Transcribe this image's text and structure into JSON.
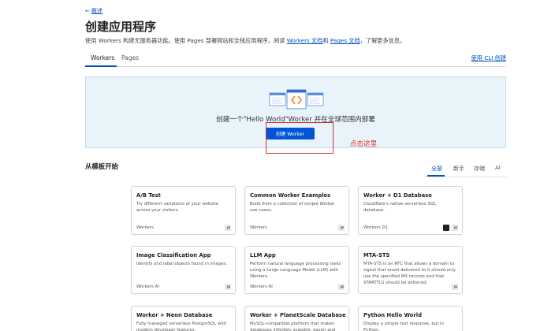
{
  "header": {
    "back_label": "概述",
    "title": "创建应用程序",
    "desc_prefix": "使用 Workers 构建无服务器功能。使用 Pages 部署网站和全栈应用程序。阅读 ",
    "workers_docs_link": "Workers 文档",
    "desc_and": "和 ",
    "pages_docs_link": "Pages 文档",
    "desc_suffix": "，了解更多信息。"
  },
  "tabs": [
    {
      "label": "Workers",
      "active": true
    },
    {
      "label": "Pages",
      "active": false
    }
  ],
  "cli_link": "使用 CLI 创建",
  "hero": {
    "text": "创建一个\"Hello World\"Worker 并在全球范围内部署",
    "button": "创建 Worker",
    "annotation": "点击这里"
  },
  "templates": {
    "title": "从模板开始",
    "filters": [
      {
        "label": "全部",
        "active": true
      },
      {
        "label": "新手",
        "active": false
      },
      {
        "label": "存储",
        "active": false
      },
      {
        "label": "AI",
        "active": false
      }
    ],
    "cards": [
      {
        "title": "A/B Test",
        "desc": "Try different variations of your website across your visitors.",
        "tags": "Workers",
        "badges": [
          "js"
        ]
      },
      {
        "title": "Common Worker Examples",
        "desc": "Build from a collection of simple Worker use cases.",
        "tags": "Workers",
        "badges": [
          "js"
        ]
      },
      {
        "title": "Worker + D1 Database",
        "desc": "Cloudflare's native serverless SQL database.",
        "tags": "Workers   D1",
        "badges": [
          "d1",
          "js"
        ]
      },
      {
        "title": "Image Classification App",
        "desc": "Identify and label objects found in images.",
        "tags": "Workers   AI",
        "badges": [
          "js"
        ]
      },
      {
        "title": "LLM App",
        "desc": "Perform natural language processing tasks using a Large Language Model (LLM) with Workers.",
        "tags": "Workers   AI",
        "badges": [
          "js"
        ]
      },
      {
        "title": "MTA-STS",
        "desc": "MTA-STS is an RFC that allows a domain to signal that email delivered to it should only use the specified MX records and that STARTTLS should be enforced.",
        "tags": "",
        "badges": [
          "js"
        ]
      },
      {
        "title": "Worker + Neon Database",
        "desc": "Fully managed serverless PostgreSQL with modern developer features.",
        "tags": "",
        "badges": []
      },
      {
        "title": "Worker + PlanetScale Database",
        "desc": "MySQL-compatible platform that makes databases infinitely scalable, easier and safer to",
        "tags": "",
        "badges": []
      },
      {
        "title": "Python Hello World",
        "desc": "Display a simple text response, but in Python.",
        "tags": "",
        "badges": []
      }
    ]
  },
  "colors": {
    "accent": "#0051c3",
    "button": "#0055d4",
    "hero_bg": "#e9f4fa",
    "annotation": "#e52b2b"
  }
}
